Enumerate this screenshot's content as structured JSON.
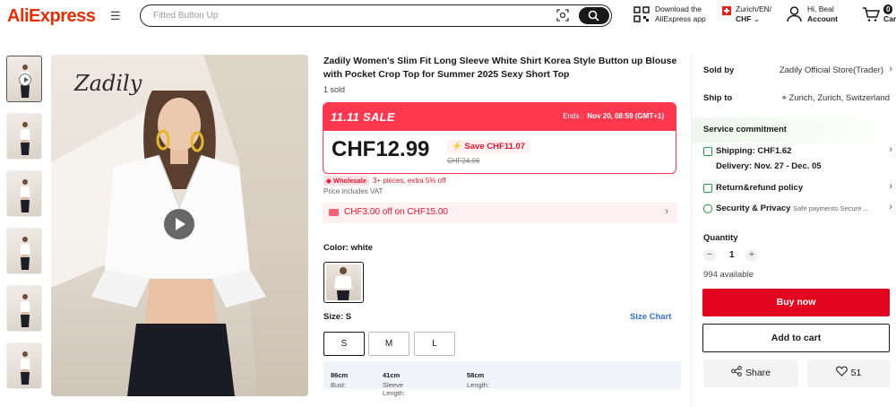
{
  "header": {
    "logo": "AliExpress",
    "search_placeholder": "Fitted Button Up",
    "download_line1": "Download the",
    "download_line2": "AliExpress app",
    "locale_line1": "Zurich/EN/",
    "locale_line2": "CHF",
    "account_line1": "Hi, Beal",
    "account_line2": "Account",
    "cart_count": "0",
    "cart_label": "Cart"
  },
  "gallery": {
    "watermark": "Zadily"
  },
  "product": {
    "title": "Zadily Women's Slim Fit Long Sleeve White Shirt Korea Style Button up Blouse with Pocket Crop Top for Summer 2025 Sexy Short Top",
    "sold": "1 sold",
    "sale_label": "11.11 SALE",
    "ends_label": "Ends :",
    "ends_value": "Nov 20, 08:59 (GMT+1)",
    "price": "CHF12.99",
    "save": "Save CHF11.07",
    "original_price": "CHF24.06",
    "wholesale_badge": "Wholesale",
    "wholesale_text": "3+ pieces, extra 5% off",
    "vat": "Price includes VAT",
    "coupon": "CHF3.00 off on CHF15.00",
    "color_label": "Color: white",
    "size_label": "Size: S",
    "size_chart": "Size Chart",
    "sizes": [
      "S",
      "M",
      "L"
    ],
    "measure": {
      "bust_label": "Bust:",
      "bust": "86cm",
      "sleeve_label": "Sleeve Length:",
      "sleeve": "41cm",
      "length_label": "Length:",
      "length": "58cm"
    }
  },
  "side": {
    "sold_by_label": "Sold by",
    "sold_by": "Zadily Official Store(Trader)",
    "ship_to_label": "Ship to",
    "ship_to": "Zurich, Zurich, Switzerland",
    "service": "Service commitment",
    "shipping": "Shipping: CHF1.62",
    "delivery": "Delivery: Nov. 27 - Dec. 05",
    "refund": "Return&refund policy",
    "security": "Security & Privacy",
    "security_sub": "Safe payments·Secure ...",
    "quantity_label": "Quantity",
    "quantity": "1",
    "available": "994 available",
    "buy_now": "Buy now",
    "add_to_cart": "Add to cart",
    "share": "Share",
    "likes": "51"
  }
}
